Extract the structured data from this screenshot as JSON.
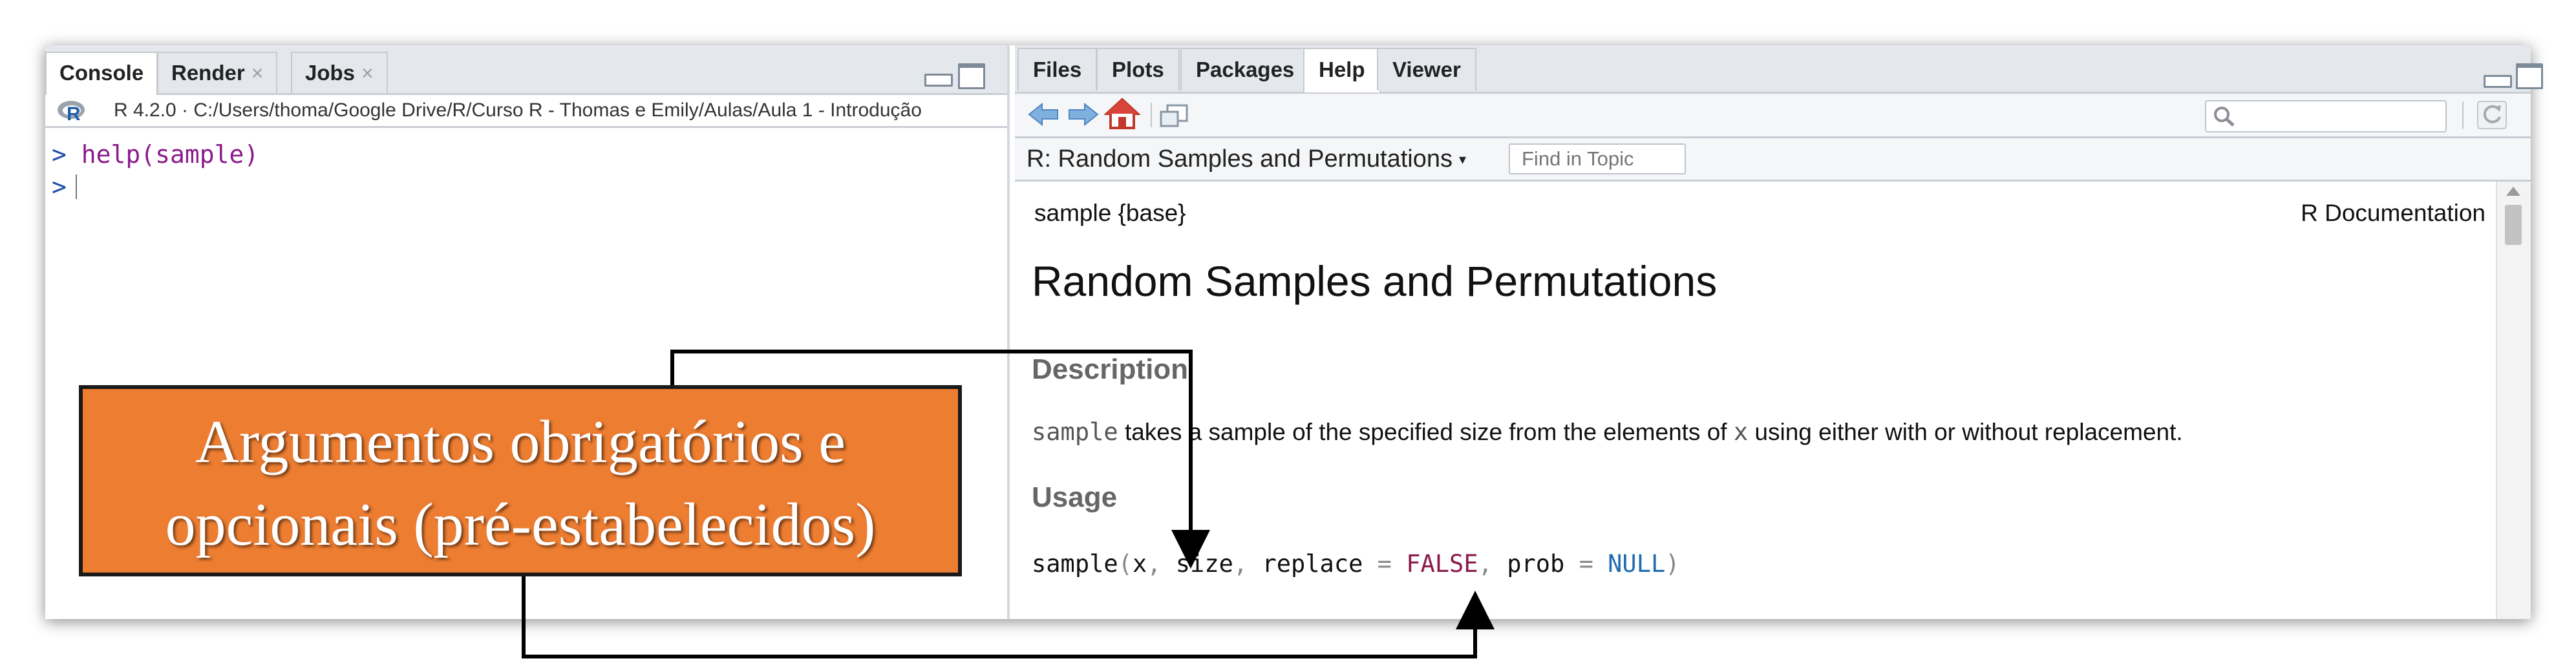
{
  "left_pane": {
    "tabs": [
      {
        "label": "Console",
        "closable": false,
        "active": true
      },
      {
        "label": "Render",
        "closable": true,
        "active": false
      },
      {
        "label": "Jobs",
        "closable": true,
        "active": false
      }
    ],
    "close_glyph": "×",
    "path_bar": {
      "icon": "r-logo-icon",
      "text": "R 4.2.0 · C:/Users/thoma/Google Drive/R/Curso R - Thomas e Emily/Aulas/Aula 1 - Introdução"
    },
    "console": {
      "prompt": ">",
      "lines": [
        "help(sample)",
        ""
      ]
    }
  },
  "right_pane": {
    "tabs": [
      {
        "label": "Files",
        "active": false
      },
      {
        "label": "Plots",
        "active": false
      },
      {
        "label": "Packages",
        "active": false
      },
      {
        "label": "Help",
        "active": true
      },
      {
        "label": "Viewer",
        "active": false
      }
    ],
    "toolbar_icons": [
      "back-arrow-icon",
      "forward-arrow-icon",
      "home-icon",
      "popout-icon",
      "search-icon",
      "refresh-icon"
    ],
    "topic_title": "R: Random Samples and Permutations",
    "topic_dropdown_glyph": "▾",
    "find_in_topic_placeholder": "Find in Topic",
    "doc": {
      "header_left": "sample {base}",
      "header_right": "R Documentation",
      "title": "Random Samples and Permutations",
      "description_heading": "Description",
      "description_code1": "sample",
      "description_text1": "takes a sample of the specified size from the elements of",
      "description_code2": "x",
      "description_text2": "using either with or without replacement.",
      "usage_heading": "Usage",
      "usage": {
        "fn": "sample",
        "open": "(",
        "arg1": "x",
        "comma": ",",
        "arg2": "size",
        "arg3": "replace",
        "eq": "=",
        "false_kw": "FALSE",
        "arg4": "prob",
        "null_kw": "NULL",
        "close": ")"
      }
    }
  },
  "annotation": {
    "line1": "Argumentos obrigatórios e",
    "line2": "opcionais (pré-estabelecidos)",
    "box_color": "#ed7d31",
    "text_color": "#ffffff",
    "arrow_color": "#000000"
  },
  "colors": {
    "tabbar_bg": "#e4e8ec",
    "console_prompt": "#1f4ea8",
    "console_command": "#8b1b8b",
    "false_keyword": "#8b1b4b",
    "null_keyword": "#1f6bb0"
  }
}
